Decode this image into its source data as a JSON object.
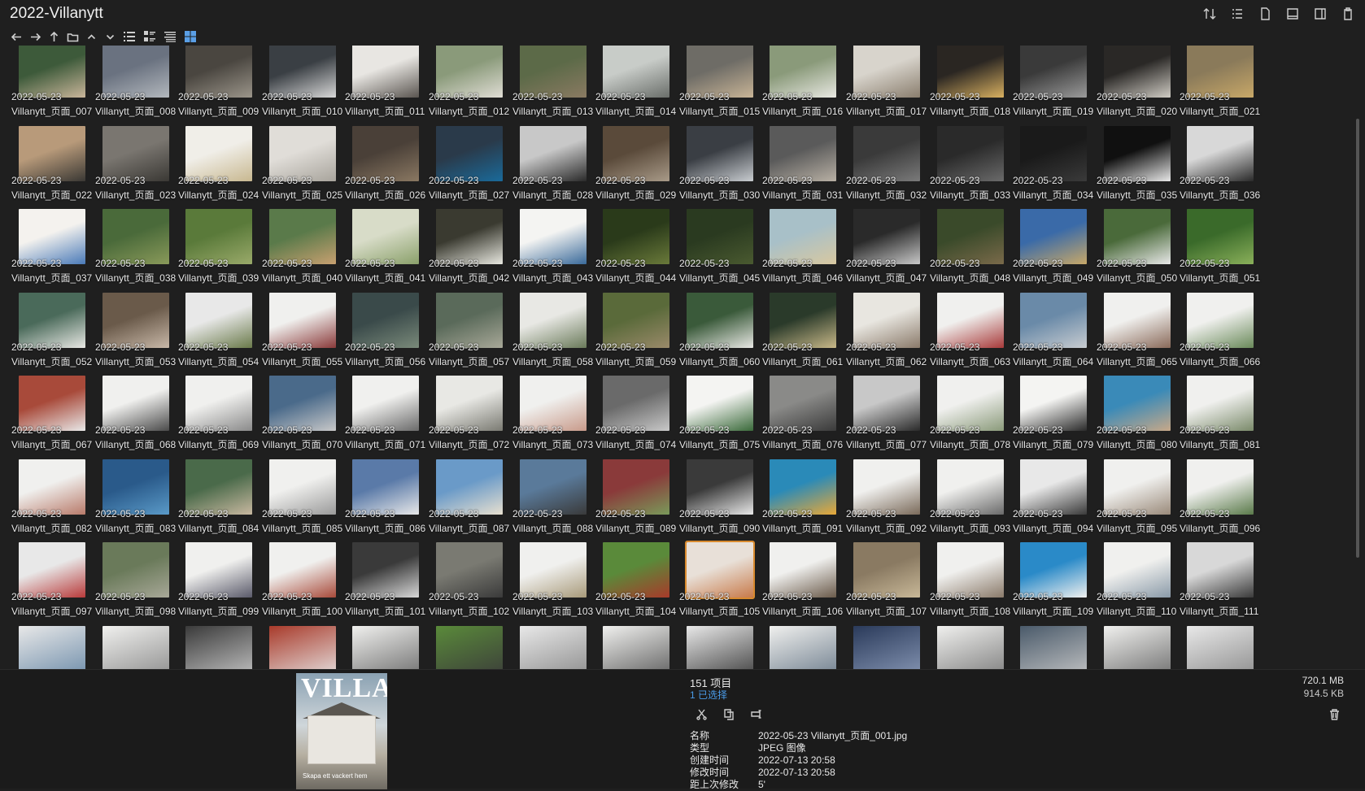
{
  "window": {
    "title": "2022-Villanytt"
  },
  "toolbar_right": [
    {
      "name": "sort-icon"
    },
    {
      "name": "details-pane-icon"
    },
    {
      "name": "page-icon"
    },
    {
      "name": "preview-pane-icon"
    },
    {
      "name": "window-icon"
    },
    {
      "name": "clipboard-icon"
    }
  ],
  "nav": [
    "back-icon",
    "forward-icon",
    "up-icon",
    "folder-icon",
    "chevron-up-icon",
    "chevron-down-icon"
  ],
  "views": [
    "list-view",
    "details-view",
    "tiles-view",
    "thumbnails-view"
  ],
  "items": [
    {
      "date": "2022-05-23",
      "name": "Villanytt_页面_007",
      "colors": [
        "#3d5a3a",
        "#c9b59a"
      ]
    },
    {
      "date": "2022-05-23",
      "name": "Villanytt_页面_008",
      "colors": [
        "#6a7280",
        "#b3b8bd"
      ]
    },
    {
      "date": "2022-05-23",
      "name": "Villanytt_页面_009",
      "colors": [
        "#4a4640",
        "#9b958a"
      ]
    },
    {
      "date": "2022-05-23",
      "name": "Villanytt_页面_010",
      "colors": [
        "#3a3f44",
        "#d8d8d8"
      ]
    },
    {
      "date": "2022-05-23",
      "name": "Villanytt_页面_011",
      "colors": [
        "#e8e6e2",
        "#5a5550"
      ]
    },
    {
      "date": "2022-05-23",
      "name": "Villanytt_页面_012",
      "colors": [
        "#8a9a7a",
        "#e0ddd5"
      ]
    },
    {
      "date": "2022-05-23",
      "name": "Villanytt_页面_013",
      "colors": [
        "#5c6a48",
        "#8a7a62"
      ]
    },
    {
      "date": "2022-05-23",
      "name": "Villanytt_页面_014",
      "colors": [
        "#c8ccc8",
        "#6a6e6a"
      ]
    },
    {
      "date": "2022-05-23",
      "name": "Villanytt_页面_015",
      "colors": [
        "#6e6c66",
        "#c8b496"
      ]
    },
    {
      "date": "2022-05-23",
      "name": "Villanytt_页面_016",
      "colors": [
        "#8a9a7a",
        "#e8e8e2"
      ]
    },
    {
      "date": "2022-05-23",
      "name": "Villanytt_页面_017",
      "colors": [
        "#d8d4cc",
        "#8a7e6e"
      ]
    },
    {
      "date": "2022-05-23",
      "name": "Villanytt_页面_018",
      "colors": [
        "#2a2622",
        "#d8b060"
      ]
    },
    {
      "date": "2022-05-23",
      "name": "Villanytt_页面_019",
      "colors": [
        "#3a3a3a",
        "#9a9a9a"
      ]
    },
    {
      "date": "2022-05-23",
      "name": "Villanytt_页面_020",
      "colors": [
        "#2a2826",
        "#d0ccc4"
      ]
    },
    {
      "date": "2022-05-23",
      "name": "Villanytt_页面_021",
      "colors": [
        "#8a7a5a",
        "#c8a868"
      ]
    },
    {
      "date": "2022-05-23",
      "name": "Villanytt_页面_022",
      "colors": [
        "#b89a7a",
        "#3a3834"
      ]
    },
    {
      "date": "2022-05-23",
      "name": "Villanytt_页面_023",
      "colors": [
        "#7a7670",
        "#3a3834"
      ]
    },
    {
      "date": "2022-05-23",
      "name": "Villanytt_页面_024",
      "colors": [
        "#f0eee8",
        "#c8b890"
      ]
    },
    {
      "date": "2022-05-23",
      "name": "Villanytt_页面_025",
      "colors": [
        "#e0ddd8",
        "#a8a49c"
      ]
    },
    {
      "date": "2022-05-23",
      "name": "Villanytt_页面_026",
      "colors": [
        "#4a4038",
        "#8a7862"
      ]
    },
    {
      "date": "2022-05-23",
      "name": "Villanytt_页面_027",
      "colors": [
        "#2a3a4a",
        "#1a6a9a"
      ]
    },
    {
      "date": "2022-05-23",
      "name": "Villanytt_页面_028",
      "colors": [
        "#c8c8c8",
        "#2a2a2a"
      ]
    },
    {
      "date": "2022-05-23",
      "name": "Villanytt_页面_029",
      "colors": [
        "#5a4a3a",
        "#a89a88"
      ]
    },
    {
      "date": "2022-05-23",
      "name": "Villanytt_页面_030",
      "colors": [
        "#3a3e44",
        "#c8ccd0"
      ]
    },
    {
      "date": "2022-05-23",
      "name": "Villanytt_页面_031",
      "colors": [
        "#5a5a5a",
        "#b8b0a4"
      ]
    },
    {
      "date": "2022-05-23",
      "name": "Villanytt_页面_032",
      "colors": [
        "#3a3a3a",
        "#7a7a7a"
      ]
    },
    {
      "date": "2022-05-23",
      "name": "Villanytt_页面_033",
      "colors": [
        "#2a2a2a",
        "#6a6a6a"
      ]
    },
    {
      "date": "2022-05-23",
      "name": "Villanytt_页面_034",
      "colors": [
        "#1a1a1a",
        "#3a3a3a"
      ]
    },
    {
      "date": "2022-05-23",
      "name": "Villanytt_页面_035",
      "colors": [
        "#101010",
        "#e8e8e8"
      ]
    },
    {
      "date": "2022-05-23",
      "name": "Villanytt_页面_036",
      "colors": [
        "#d8d8d8",
        "#2a2a2a"
      ]
    },
    {
      "date": "2022-05-23",
      "name": "Villanytt_页面_037",
      "colors": [
        "#f4f2ee",
        "#4a7ab8"
      ]
    },
    {
      "date": "2022-05-23",
      "name": "Villanytt_页面_038",
      "colors": [
        "#4a6a3a",
        "#8a9a5a"
      ]
    },
    {
      "date": "2022-05-23",
      "name": "Villanytt_页面_039",
      "colors": [
        "#5a7a3a",
        "#9aaa6a"
      ]
    },
    {
      "date": "2022-05-23",
      "name": "Villanytt_页面_040",
      "colors": [
        "#5a7a4a",
        "#c8a070"
      ]
    },
    {
      "date": "2022-05-23",
      "name": "Villanytt_页面_041",
      "colors": [
        "#d8dcc8",
        "#8aa06a"
      ]
    },
    {
      "date": "2022-05-23",
      "name": "Villanytt_页面_042",
      "colors": [
        "#3a3a30",
        "#e8e8e0"
      ]
    },
    {
      "date": "2022-05-23",
      "name": "Villanytt_页面_043",
      "colors": [
        "#f4f4f2",
        "#3a6a9a"
      ]
    },
    {
      "date": "2022-05-23",
      "name": "Villanytt_页面_044",
      "colors": [
        "#2a3a1a",
        "#6a7a3a"
      ]
    },
    {
      "date": "2022-05-23",
      "name": "Villanytt_页面_045",
      "colors": [
        "#2a3a20",
        "#4a5a30"
      ]
    },
    {
      "date": "2022-05-23",
      "name": "Villanytt_页面_046",
      "colors": [
        "#a8c0c8",
        "#d8c8a0"
      ]
    },
    {
      "date": "2022-05-23",
      "name": "Villanytt_页面_047",
      "colors": [
        "#2a2a2a",
        "#c8c8c8"
      ]
    },
    {
      "date": "2022-05-23",
      "name": "Villanytt_页面_048",
      "colors": [
        "#3a4a2a",
        "#7a6a4a"
      ]
    },
    {
      "date": "2022-05-23",
      "name": "Villanytt_页面_049",
      "colors": [
        "#3a6aa8",
        "#c8a868"
      ]
    },
    {
      "date": "2022-05-23",
      "name": "Villanytt_页面_050",
      "colors": [
        "#4a6a3a",
        "#e8e8e8"
      ]
    },
    {
      "date": "2022-05-23",
      "name": "Villanytt_页面_051",
      "colors": [
        "#3a6a2a",
        "#8ab05a"
      ]
    },
    {
      "date": "2022-05-23",
      "name": "Villanytt_页面_052",
      "colors": [
        "#4a6a5a",
        "#e8e8e4"
      ]
    },
    {
      "date": "2022-05-23",
      "name": "Villanytt_页面_053",
      "colors": [
        "#6a5a4a",
        "#c8b8a8"
      ]
    },
    {
      "date": "2022-05-23",
      "name": "Villanytt_页面_054",
      "colors": [
        "#e8e8e8",
        "#6a7a4a"
      ]
    },
    {
      "date": "2022-05-23",
      "name": "Villanytt_页面_055",
      "colors": [
        "#f0f0ee",
        "#8a3a3a"
      ]
    },
    {
      "date": "2022-05-23",
      "name": "Villanytt_页面_056",
      "colors": [
        "#3a4a4a",
        "#7a8a7a"
      ]
    },
    {
      "date": "2022-05-23",
      "name": "Villanytt_页面_057",
      "colors": [
        "#5a6a5a",
        "#a8a898"
      ]
    },
    {
      "date": "2022-05-23",
      "name": "Villanytt_页面_058",
      "colors": [
        "#e8e8e4",
        "#6a7a5a"
      ]
    },
    {
      "date": "2022-05-23",
      "name": "Villanytt_页面_059",
      "colors": [
        "#5a6a3a",
        "#9a8a6a"
      ]
    },
    {
      "date": "2022-05-23",
      "name": "Villanytt_页面_060",
      "colors": [
        "#3a5a3a",
        "#e8e8e4"
      ]
    },
    {
      "date": "2022-05-23",
      "name": "Villanytt_页面_061",
      "colors": [
        "#2a3a2a",
        "#c8b888"
      ]
    },
    {
      "date": "2022-05-23",
      "name": "Villanytt_页面_062",
      "colors": [
        "#e8e6e0",
        "#8a7a6a"
      ]
    },
    {
      "date": "2022-05-23",
      "name": "Villanytt_页面_063",
      "colors": [
        "#f0f0ee",
        "#a83a3a"
      ]
    },
    {
      "date": "2022-05-23",
      "name": "Villanytt_页面_064",
      "colors": [
        "#6a8aa8",
        "#c8ccd0"
      ]
    },
    {
      "date": "2022-05-23",
      "name": "Villanytt_页面_065",
      "colors": [
        "#f0f0ee",
        "#8a6a5a"
      ]
    },
    {
      "date": "2022-05-23",
      "name": "Villanytt_页面_066",
      "colors": [
        "#f0f0ee",
        "#6a8a5a"
      ]
    },
    {
      "date": "2022-05-23",
      "name": "Villanytt_页面_067",
      "colors": [
        "#a84a3a",
        "#e8e8e8"
      ]
    },
    {
      "date": "2022-05-23",
      "name": "Villanytt_页面_068",
      "colors": [
        "#f0f0ee",
        "#4a4a4a"
      ]
    },
    {
      "date": "2022-05-23",
      "name": "Villanytt_页面_069",
      "colors": [
        "#f0f0ee",
        "#8a8a8a"
      ]
    },
    {
      "date": "2022-05-23",
      "name": "Villanytt_页面_070",
      "colors": [
        "#4a6a8a",
        "#c8c8c8"
      ]
    },
    {
      "date": "2022-05-23",
      "name": "Villanytt_页面_071",
      "colors": [
        "#f0f0ee",
        "#6a6a6a"
      ]
    },
    {
      "date": "2022-05-23",
      "name": "Villanytt_页面_072",
      "colors": [
        "#e8e8e4",
        "#7a7a72"
      ]
    },
    {
      "date": "2022-05-23",
      "name": "Villanytt_页面_073",
      "colors": [
        "#f0f0ee",
        "#c89a8a"
      ]
    },
    {
      "date": "2022-05-23",
      "name": "Villanytt_页面_074",
      "colors": [
        "#6a6a6a",
        "#c8c8c8"
      ]
    },
    {
      "date": "2022-05-23",
      "name": "Villanytt_页面_075",
      "colors": [
        "#f4f4f2",
        "#3a6a3a"
      ]
    },
    {
      "date": "2022-05-23",
      "name": "Villanytt_页面_076",
      "colors": [
        "#8a8a88",
        "#3a3a3a"
      ]
    },
    {
      "date": "2022-05-23",
      "name": "Villanytt_页面_077",
      "colors": [
        "#c8c8c8",
        "#2a2a2a"
      ]
    },
    {
      "date": "2022-05-23",
      "name": "Villanytt_页面_078",
      "colors": [
        "#f0f0ee",
        "#8a9a7a"
      ]
    },
    {
      "date": "2022-05-23",
      "name": "Villanytt_页面_079",
      "colors": [
        "#f4f4f2",
        "#2a2a2a"
      ]
    },
    {
      "date": "2022-05-23",
      "name": "Villanytt_页面_080",
      "colors": [
        "#3a8ab8",
        "#c8a888"
      ]
    },
    {
      "date": "2022-05-23",
      "name": "Villanytt_页面_081",
      "colors": [
        "#f0f0ee",
        "#7a8a6a"
      ]
    },
    {
      "date": "2022-05-23",
      "name": "Villanytt_页面_082",
      "colors": [
        "#f0f0ee",
        "#b87a6a"
      ]
    },
    {
      "date": "2022-05-23",
      "name": "Villanytt_页面_083",
      "colors": [
        "#2a5a8a",
        "#5a9ac8"
      ]
    },
    {
      "date": "2022-05-23",
      "name": "Villanytt_页面_084",
      "colors": [
        "#4a6a4a",
        "#c8b8a0"
      ]
    },
    {
      "date": "2022-05-23",
      "name": "Villanytt_页面_085",
      "colors": [
        "#f0f0ee",
        "#9a9a9a"
      ]
    },
    {
      "date": "2022-05-23",
      "name": "Villanytt_页面_086",
      "colors": [
        "#5a7aa8",
        "#e8e8e8"
      ]
    },
    {
      "date": "2022-05-23",
      "name": "Villanytt_页面_087",
      "colors": [
        "#6a9ac8",
        "#e8e0d0"
      ]
    },
    {
      "date": "2022-05-23",
      "name": "Villanytt_页面_088",
      "colors": [
        "#5a7a9a",
        "#3a3a3a"
      ]
    },
    {
      "date": "2022-05-23",
      "name": "Villanytt_页面_089",
      "colors": [
        "#8a3a3a",
        "#7a9a5a"
      ]
    },
    {
      "date": "2022-05-23",
      "name": "Villanytt_页面_090",
      "colors": [
        "#3a3a3a",
        "#e8e8e8"
      ]
    },
    {
      "date": "2022-05-23",
      "name": "Villanytt_页面_091",
      "colors": [
        "#2a8ab8",
        "#e8a838"
      ]
    },
    {
      "date": "2022-05-23",
      "name": "Villanytt_页面_092",
      "colors": [
        "#f0f0ee",
        "#7a6a5a"
      ]
    },
    {
      "date": "2022-05-23",
      "name": "Villanytt_页面_093",
      "colors": [
        "#f0f0ee",
        "#6a6a6a"
      ]
    },
    {
      "date": "2022-05-23",
      "name": "Villanytt_页面_094",
      "colors": [
        "#e8e8e8",
        "#3a3a3a"
      ]
    },
    {
      "date": "2022-05-23",
      "name": "Villanytt_页面_095",
      "colors": [
        "#f0f0ee",
        "#9a8a7a"
      ]
    },
    {
      "date": "2022-05-23",
      "name": "Villanytt_页面_096",
      "colors": [
        "#f0f0ee",
        "#5a7a4a"
      ]
    },
    {
      "date": "2022-05-23",
      "name": "Villanytt_页面_097",
      "colors": [
        "#e8e8e8",
        "#b83a3a"
      ]
    },
    {
      "date": "2022-05-23",
      "name": "Villanytt_页面_098",
      "colors": [
        "#6a7a5a",
        "#a8a898"
      ]
    },
    {
      "date": "2022-05-23",
      "name": "Villanytt_页面_099",
      "colors": [
        "#f0f0ee",
        "#5a5a6a"
      ]
    },
    {
      "date": "2022-05-23",
      "name": "Villanytt_页面_100",
      "colors": [
        "#f0f0ee",
        "#a84a3a"
      ]
    },
    {
      "date": "2022-05-23",
      "name": "Villanytt_页面_101",
      "colors": [
        "#3a3a3a",
        "#d8d8d8"
      ]
    },
    {
      "date": "2022-05-23",
      "name": "Villanytt_页面_102",
      "colors": [
        "#7a7a72",
        "#3a3a3a"
      ]
    },
    {
      "date": "2022-05-23",
      "name": "Villanytt_页面_103",
      "colors": [
        "#f0f0ee",
        "#a89a7a"
      ]
    },
    {
      "date": "2022-05-23",
      "name": "Villanytt_页面_104",
      "colors": [
        "#5a8a3a",
        "#a83a2a"
      ]
    },
    {
      "date": "2022-05-23",
      "name": "Villanytt_页面_105",
      "colors": [
        "#e8e0d8",
        "#c87a4a"
      ]
    },
    {
      "date": "2022-05-23",
      "name": "Villanytt_页面_106",
      "colors": [
        "#f0f0ee",
        "#6a5a4a"
      ]
    },
    {
      "date": "2022-05-23",
      "name": "Villanytt_页面_107",
      "colors": [
        "#8a7a62",
        "#c8b898"
      ]
    },
    {
      "date": "2022-05-23",
      "name": "Villanytt_页面_108",
      "colors": [
        "#f0f0ee",
        "#8a7a6a"
      ]
    },
    {
      "date": "2022-05-23",
      "name": "Villanytt_页面_109",
      "colors": [
        "#2a8ac8",
        "#f0f0ee"
      ]
    },
    {
      "date": "2022-05-23",
      "name": "Villanytt_页面_110",
      "colors": [
        "#f0f0ee",
        "#8a9aa8"
      ]
    },
    {
      "date": "2022-05-23",
      "name": "Villanytt_页面_111",
      "colors": [
        "#d8d8d8",
        "#3a3a3a"
      ]
    }
  ],
  "partial_row_colors": [
    [
      "#e8e8e8",
      "#6a8aa8"
    ],
    [
      "#f0f0ee",
      "#8a8a8a"
    ],
    [
      "#3a3a3a",
      "#c8c8c8"
    ],
    [
      "#a83a2a",
      "#e8e8e8"
    ],
    [
      "#f0f0ee",
      "#6a6a6a"
    ],
    [
      "#5a8a3a",
      "#3a3a3a"
    ],
    [
      "#e8e8e8",
      "#8a8a8a"
    ],
    [
      "#f0f0ee",
      "#5a5a5a"
    ],
    [
      "#e8e8e8",
      "#3a3a3a"
    ],
    [
      "#f0f0ee",
      "#6a7a8a"
    ],
    [
      "#2a3a5a",
      "#8a9ab8"
    ],
    [
      "#f0f0ee",
      "#7a7a7a"
    ],
    [
      "#4a5a6a",
      "#c8c8c8"
    ],
    [
      "#f0f0ee",
      "#6a6a6a"
    ],
    [
      "#e8e8e8",
      "#8a8a8a"
    ]
  ],
  "selected_index": 98,
  "status": {
    "count": "151 项目",
    "selected": "1 已选择",
    "total_size": "720.1 MB",
    "selected_size": "914.5 KB"
  },
  "preview": {
    "logo": "VILLA",
    "caption": "Skapa ett vackert hem"
  },
  "actions": [
    "cut-icon",
    "copy-icon",
    "rename-icon"
  ],
  "properties": [
    {
      "key": "名称",
      "value": "2022-05-23 Villanytt_页面_001.jpg"
    },
    {
      "key": "类型",
      "value": "JPEG 图像"
    },
    {
      "key": "创建时间",
      "value": "2022-07-13  20:58"
    },
    {
      "key": "修改时间",
      "value": "2022-07-13  20:58"
    },
    {
      "key": "距上次修改",
      "value": "5'"
    }
  ]
}
